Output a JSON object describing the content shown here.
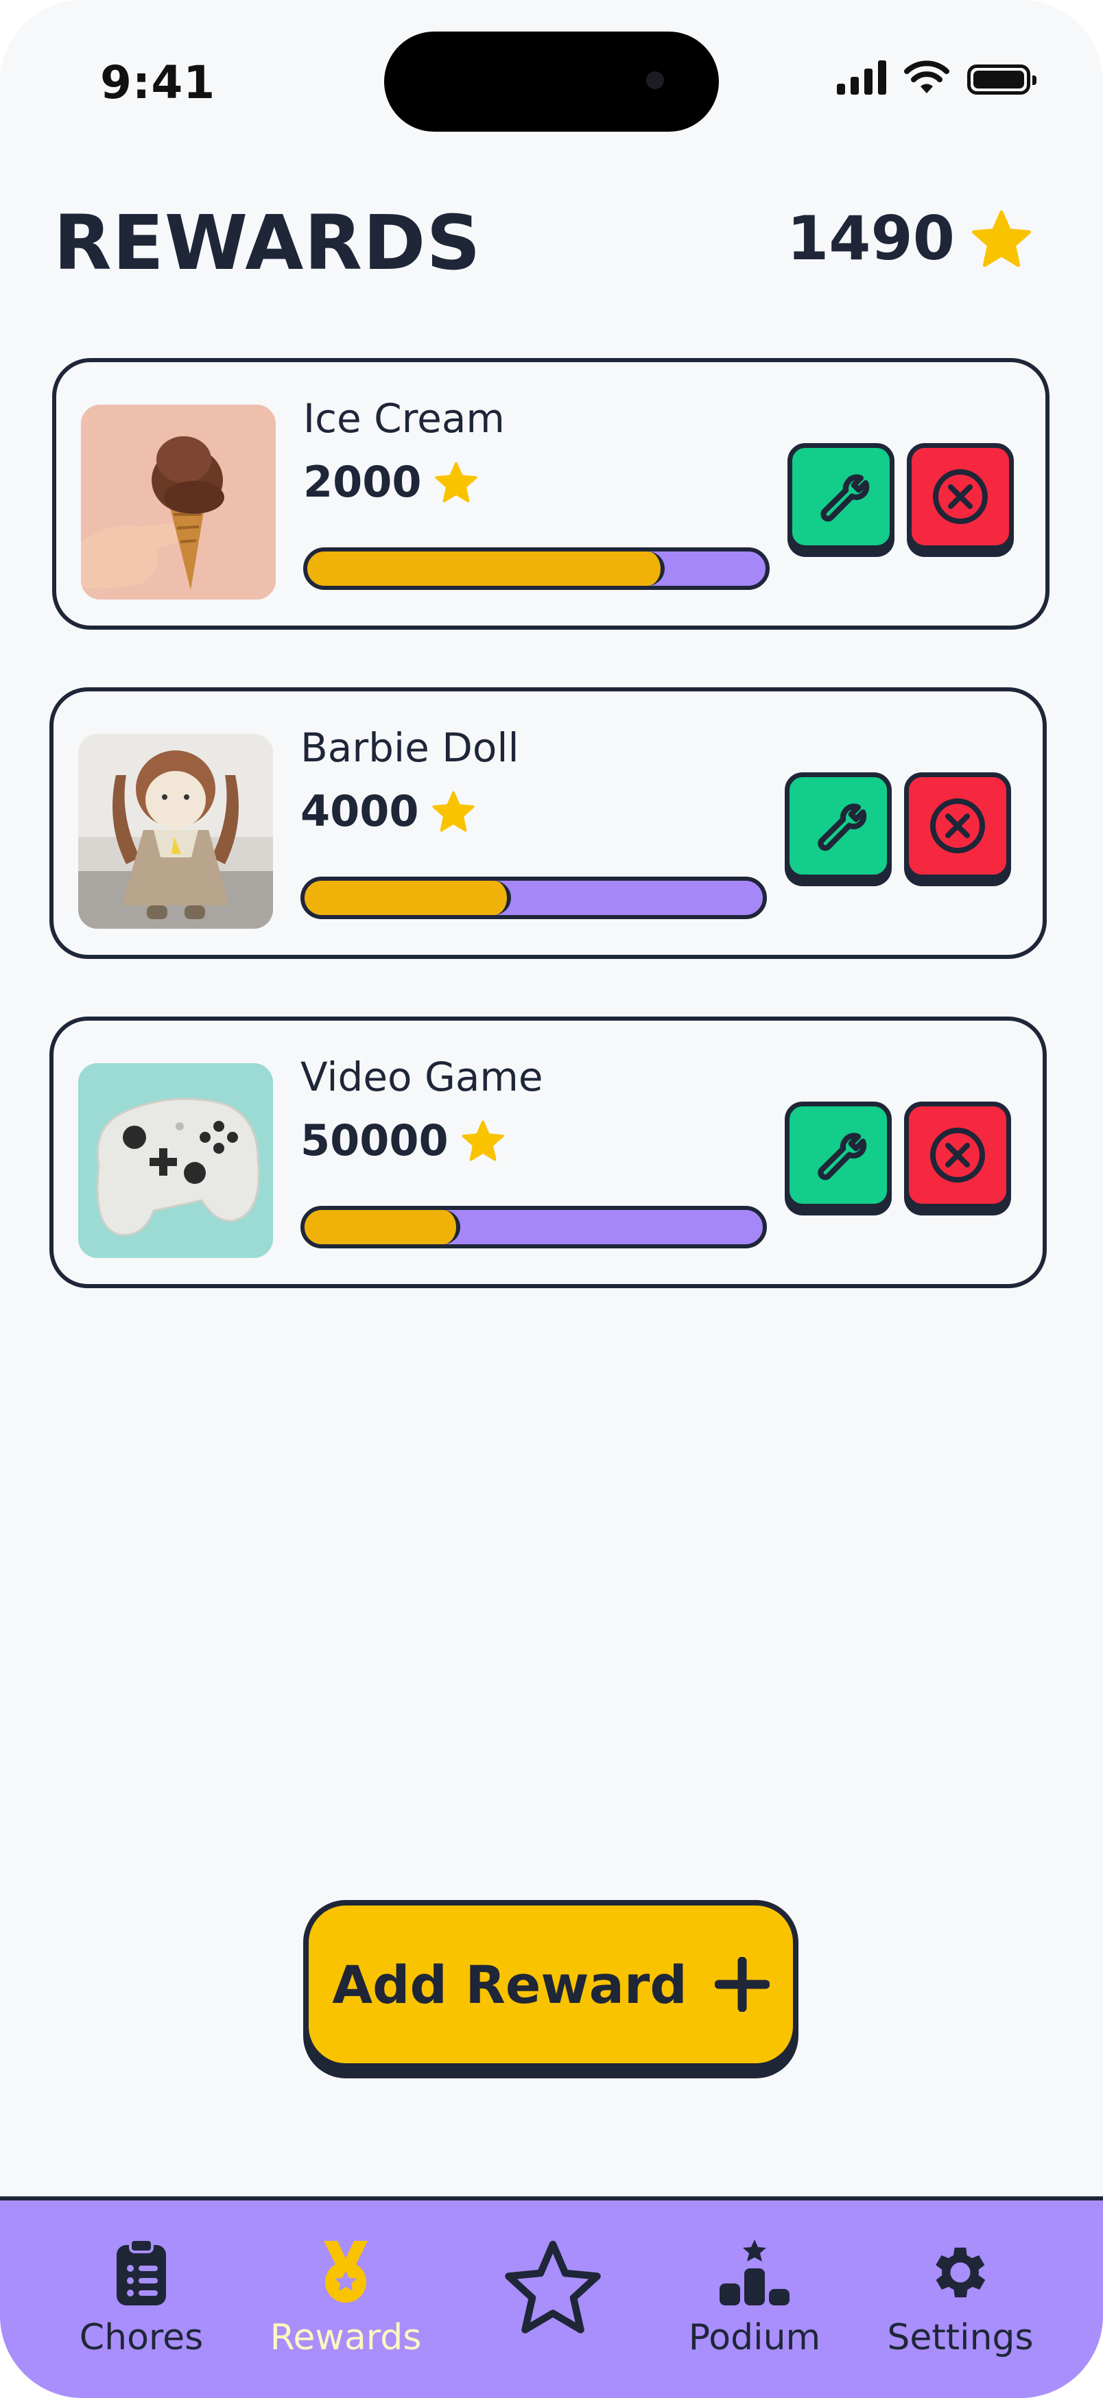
{
  "status_bar": {
    "time": "9:41"
  },
  "header": {
    "title": "REWARDS",
    "balance": "1490"
  },
  "rewards": [
    {
      "name": "Ice Cream",
      "cost": "2000",
      "progress": 0.78
    },
    {
      "name": "Barbie Doll",
      "cost": "4000",
      "progress": 0.45
    },
    {
      "name": "Video Game",
      "cost": "50000",
      "progress": 0.34
    }
  ],
  "add_button": {
    "label": "Add Reward"
  },
  "nav": {
    "items": [
      {
        "label": "Chores",
        "icon": "clipboard-list-icon"
      },
      {
        "label": "Rewards",
        "icon": "medal-icon"
      },
      {
        "label": "",
        "icon": "star-outline-icon"
      },
      {
        "label": "Podium",
        "icon": "podium-icon"
      },
      {
        "label": "Settings",
        "icon": "gear-icon"
      }
    ],
    "active": "Rewards"
  },
  "colors": {
    "star": "#f9c300",
    "progress_fill": "#f0b208",
    "progress_track": "#a687f8",
    "edit": "#13cd8a",
    "delete": "#f5283f",
    "nav_bg": "#a98ffb",
    "ink": "#1e2638"
  }
}
